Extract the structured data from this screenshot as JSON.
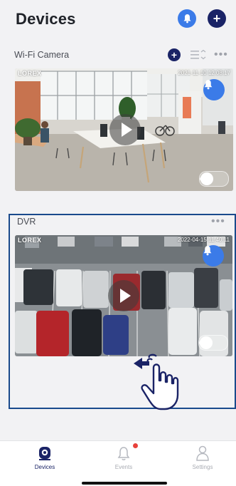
{
  "header": {
    "title": "Devices"
  },
  "sections": {
    "wifi": {
      "label": "Wi-Fi Camera",
      "camera": {
        "brand": "LOREX",
        "timestamp": "2021-11-10 12:08:17"
      }
    },
    "dvr": {
      "label": "DVR",
      "camera": {
        "brand": "LOREX",
        "timestamp": "2022-04-15 11:40:11"
      }
    }
  },
  "tabs": [
    {
      "label": "Devices",
      "icon": "camera-icon",
      "active": true
    },
    {
      "label": "Events",
      "icon": "bell-icon",
      "active": false,
      "badge": true
    },
    {
      "label": "Settings",
      "icon": "person-icon",
      "active": false
    }
  ],
  "colors": {
    "accent": "#3b7be8",
    "navy": "#1a2366",
    "frame": "#1a4a8c",
    "badge": "#e8413b"
  }
}
